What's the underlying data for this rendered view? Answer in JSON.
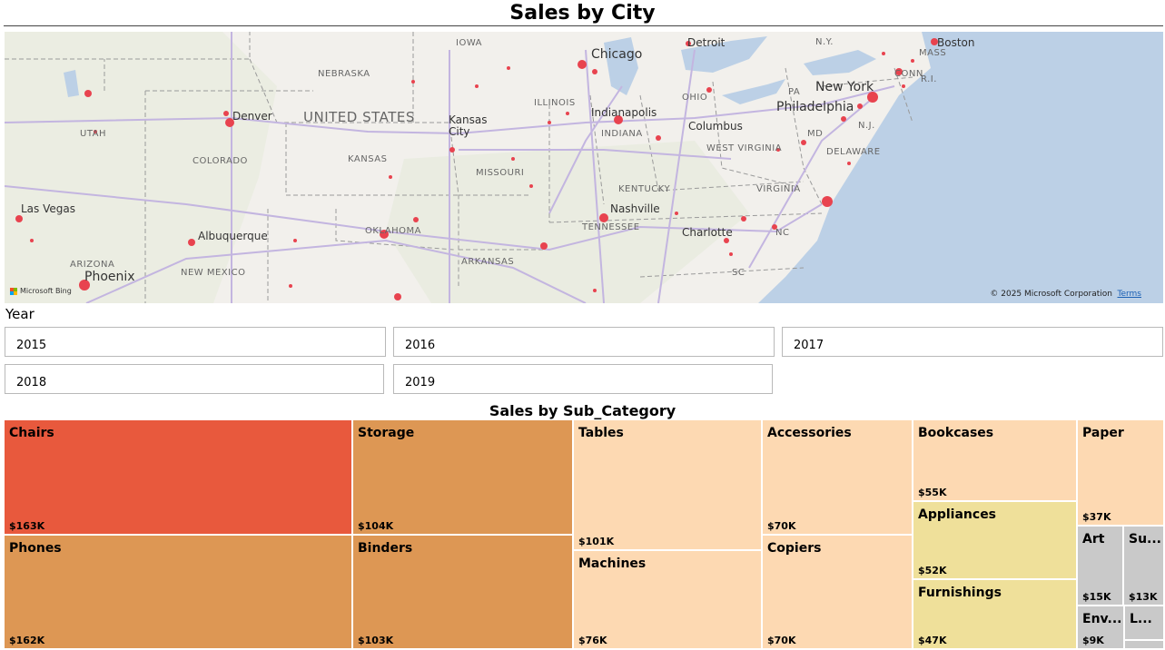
{
  "page_title": "Sales by City",
  "map": {
    "states": [
      "IOWA",
      "NEBRASKA",
      "UTAH",
      "COLORADO",
      "KANSAS",
      "MISSOURI",
      "ILLINOIS",
      "INDIANA",
      "OHIO",
      "PA",
      "N.Y.",
      "MASS",
      "CONN",
      "R.I.",
      "N.J.",
      "MD",
      "DELAWARE",
      "WEST VIRGINIA",
      "VIRGINIA",
      "KENTUCKY",
      "TENNESSEE",
      "NC",
      "SC",
      "OKLAHOMA",
      "ARKANSAS",
      "NEW MEXICO",
      "ARIZONA"
    ],
    "cities": [
      "Detroit",
      "Chicago",
      "Boston",
      "New York",
      "Philadelphia",
      "Denver",
      "Kansas City",
      "Indianapolis",
      "Columbus",
      "Nashville",
      "Charlotte",
      "Las Vegas",
      "Albuquerque",
      "Phoenix"
    ],
    "country": "UNITED STATES",
    "attribution": "© 2025 Microsoft Corporation",
    "terms": "Terms",
    "provider": "Microsoft Bing"
  },
  "year_slicer": {
    "label": "Year",
    "options": [
      "2015",
      "2016",
      "2017",
      "2018",
      "2019"
    ]
  },
  "treemap": {
    "title": "Sales by Sub_Category",
    "tiles": [
      {
        "label": "Chairs",
        "value": "$163K",
        "color": "#e8593d"
      },
      {
        "label": "Phones",
        "value": "$162K",
        "color": "#dd9754"
      },
      {
        "label": "Storage",
        "value": "$104K",
        "color": "#dd9754"
      },
      {
        "label": "Binders",
        "value": "$103K",
        "color": "#dd9754"
      },
      {
        "label": "Tables",
        "value": "$101K",
        "color": "#fdd9b2"
      },
      {
        "label": "Machines",
        "value": "$76K",
        "color": "#fdd9b2"
      },
      {
        "label": "Accessories",
        "value": "$70K",
        "color": "#fdd9b2"
      },
      {
        "label": "Copiers",
        "value": "$70K",
        "color": "#fdd9b2"
      },
      {
        "label": "Bookcases",
        "value": "$55K",
        "color": "#fdd9b2"
      },
      {
        "label": "Appliances",
        "value": "$52K",
        "color": "#efe09a"
      },
      {
        "label": "Furnishings",
        "value": "$47K",
        "color": "#efe09a"
      },
      {
        "label": "Paper",
        "value": "$37K",
        "color": "#fdd9b2"
      },
      {
        "label": "Art",
        "value": "$15K",
        "color": "#c9c9c9"
      },
      {
        "label": "Su...",
        "value": "$13K",
        "color": "#c9c9c9"
      },
      {
        "label": "Env...",
        "value": "$9K",
        "color": "#c9c9c9"
      },
      {
        "label": "L...",
        "value": "",
        "color": "#c9c9c9"
      }
    ]
  }
}
